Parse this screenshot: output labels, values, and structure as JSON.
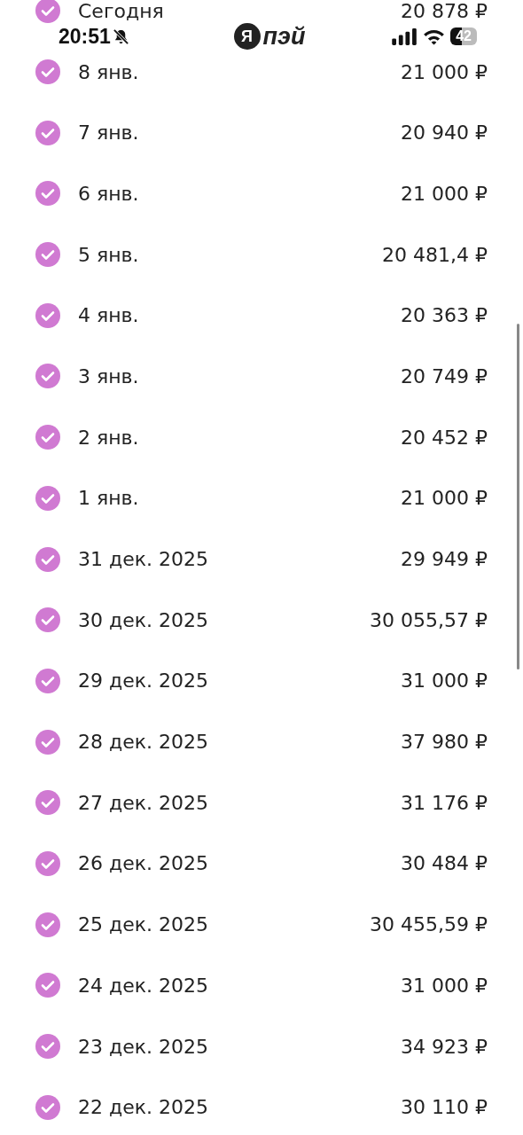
{
  "status_bar": {
    "time": "20:51",
    "battery": "42"
  },
  "logo": {
    "mark": "Я",
    "text": "пэй"
  },
  "payments": [
    {
      "date": "Сегодня",
      "amount": "20 878 ₽",
      "checked": true
    },
    {
      "date": "8 янв.",
      "amount": "21 000 ₽",
      "checked": true
    },
    {
      "date": "7 янв.",
      "amount": "20 940 ₽",
      "checked": true
    },
    {
      "date": "6 янв.",
      "amount": "21 000 ₽",
      "checked": true
    },
    {
      "date": "5 янв.",
      "amount": "20 481,4 ₽",
      "checked": true
    },
    {
      "date": "4 янв.",
      "amount": "20 363 ₽",
      "checked": true
    },
    {
      "date": "3 янв.",
      "amount": "20 749 ₽",
      "checked": true
    },
    {
      "date": "2 янв.",
      "amount": "20 452 ₽",
      "checked": true
    },
    {
      "date": "1 янв.",
      "amount": "21 000 ₽",
      "checked": true
    },
    {
      "date": "31 дек. 2025",
      "amount": "29 949 ₽",
      "checked": true
    },
    {
      "date": "30 дек. 2025",
      "amount": "30 055,57 ₽",
      "checked": true
    },
    {
      "date": "29 дек. 2025",
      "amount": "31 000 ₽",
      "checked": true
    },
    {
      "date": "28 дек. 2025",
      "amount": "37 980 ₽",
      "checked": true
    },
    {
      "date": "27 дек. 2025",
      "amount": "31 176 ₽",
      "checked": true
    },
    {
      "date": "26 дек. 2025",
      "amount": "30 484 ₽",
      "checked": true
    },
    {
      "date": "25 дек. 2025",
      "amount": "30 455,59 ₽",
      "checked": true
    },
    {
      "date": "24 дек. 2025",
      "amount": "31 000 ₽",
      "checked": true
    },
    {
      "date": "23 дек. 2025",
      "amount": "34 923 ₽",
      "checked": true
    },
    {
      "date": "22 дек. 2025",
      "amount": "30 110 ₽",
      "checked": true
    }
  ]
}
